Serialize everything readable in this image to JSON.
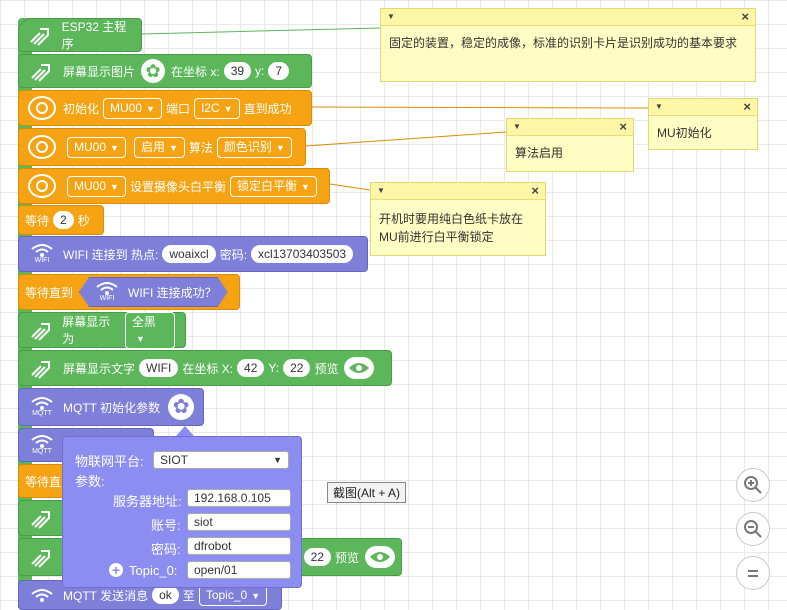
{
  "blocks": {
    "main": "ESP32 主程序",
    "show_image": {
      "label": "屏幕显示图片",
      "at": "在坐标 x:",
      "x": "39",
      "y_label": "y:",
      "y": "7"
    },
    "init": {
      "label": "初始化",
      "mu": "MU00",
      "port_label": "端口",
      "port": "I2C",
      "until": "直到成功"
    },
    "enable": {
      "mu": "MU00",
      "action": "启用",
      "algo_label": "算法",
      "algo": "颜色识别"
    },
    "wb": {
      "mu": "MU00",
      "label": "设置摄像头白平衡",
      "mode": "锁定白平衡"
    },
    "wait": {
      "label": "等待",
      "value": "2",
      "unit": "秒"
    },
    "wifi": {
      "icon_text": "WIFI",
      "label": "WIFI 连接到 热点:",
      "ssid": "woaixcl",
      "pwd_label": "密码:",
      "pwd": "xcl13703403503"
    },
    "wait_until": {
      "label": "等待直到",
      "icon_text": "WIFI",
      "cond": "WIFI 连接成功？"
    },
    "screen_fill": {
      "label": "屏幕显示为",
      "value": "全黑"
    },
    "screen_text": {
      "label": "屏幕显示文字",
      "text": "WIFI",
      "at": "在坐标 X:",
      "x": "42",
      "y_label": "Y:",
      "y": "22",
      "preview": "预览"
    },
    "mqtt_init": {
      "icon_text": "MQTT",
      "label": "MQTT 初始化参数"
    },
    "mqtt_icon2": "MQTT",
    "wait_partial": "等待直",
    "row_y22": {
      "y": "22",
      "preview": "预览"
    },
    "mqtt_send": {
      "label": "MQTT 发送消息",
      "msg": "ok",
      "to": "至",
      "topic": "Topic_0"
    }
  },
  "notes": {
    "n1": "固定的装置，稳定的成像，标准的识别卡片是识别成功的基本要求",
    "n2": "MU初始化",
    "n3": "算法启用",
    "n4": "开机时要用纯白色纸卡放在MU前进行白平衡锁定"
  },
  "popup": {
    "platform_label": "物联网平台:",
    "platform": "SIOT",
    "params_label": "参数:",
    "server_label": "服务器地址:",
    "server": "192.168.0.105",
    "account_label": "账号:",
    "account": "siot",
    "password_label": "密码:",
    "password": "dfrobot",
    "topic_label": "Topic_0:",
    "topic": "open/01"
  },
  "tooltip": "截图(Alt + A)",
  "colors": {
    "green": "#5cb65a",
    "orange": "#f6a313",
    "purple": "#7d7fd9",
    "note": "#fefdc3"
  }
}
